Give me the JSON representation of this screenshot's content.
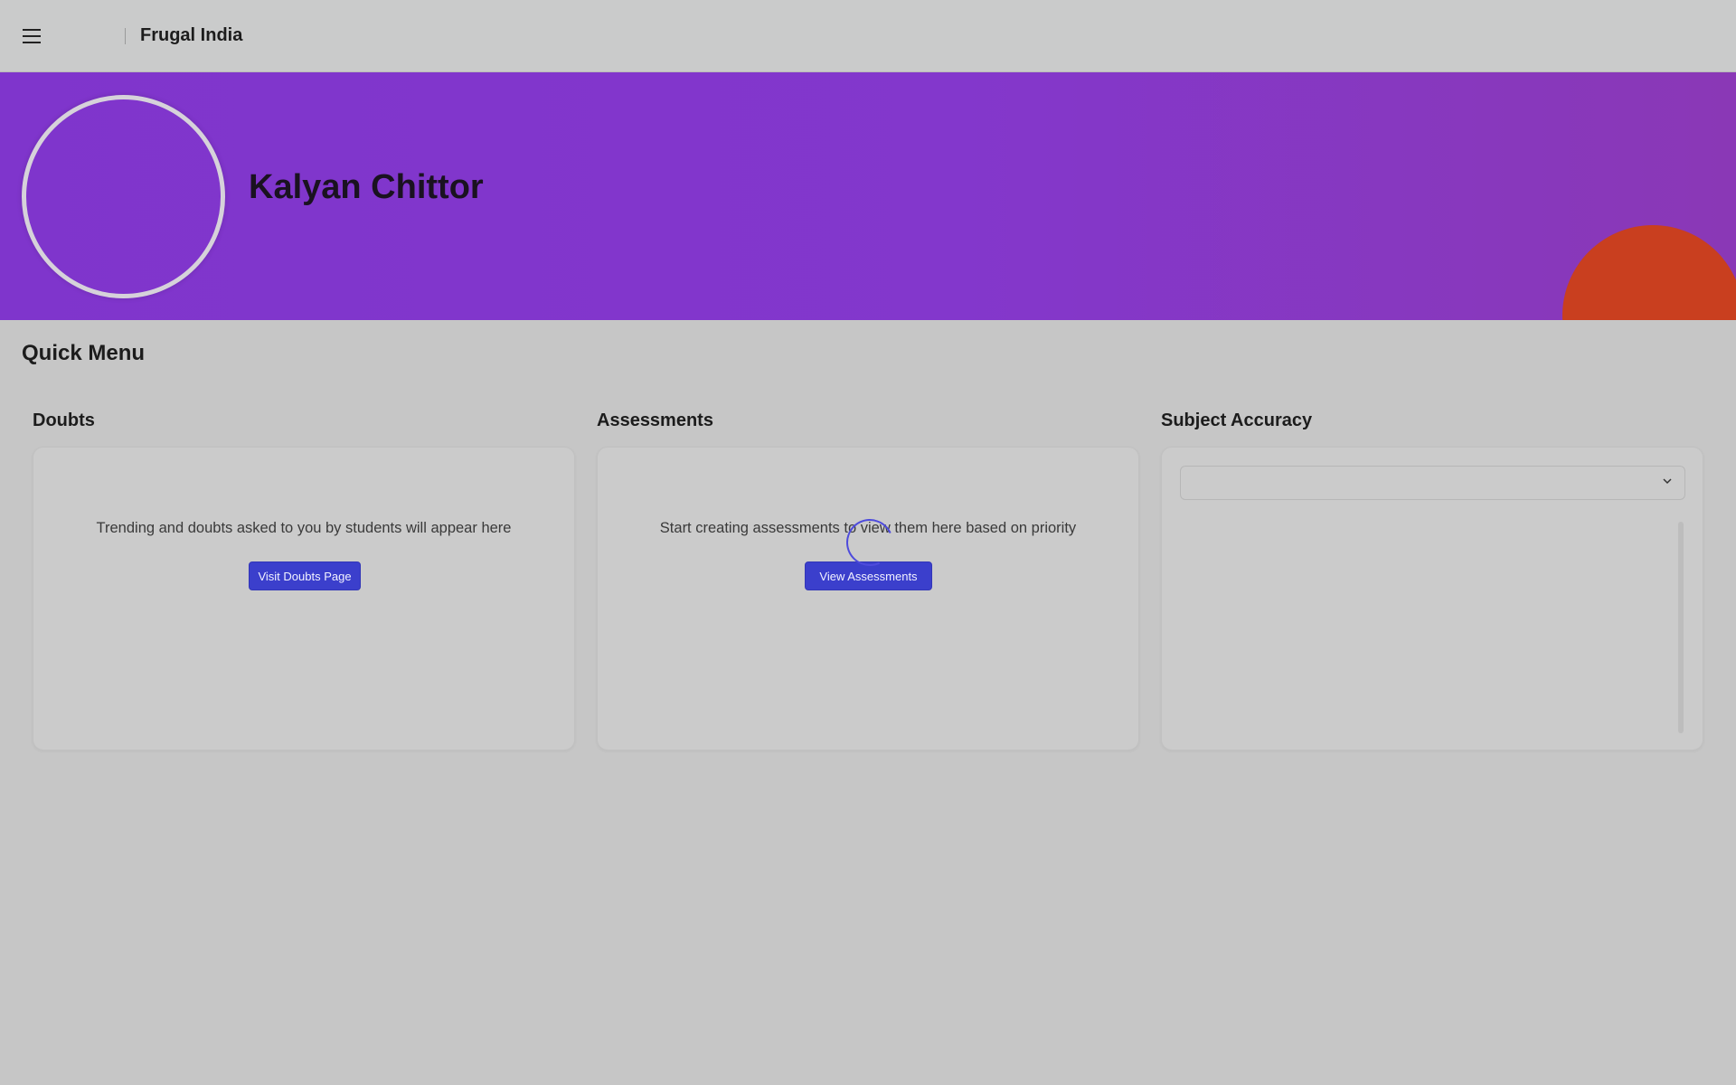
{
  "header": {
    "org_name": "Frugal India",
    "menu_icon": "hamburger-menu-icon"
  },
  "profile": {
    "name": "Kalyan Chittor"
  },
  "quick_menu": {
    "title": "Quick Menu",
    "doubts": {
      "title": "Doubts",
      "message": "Trending and doubts asked to you by students will appear here",
      "button_label": "Visit Doubts Page"
    },
    "assessments": {
      "title": "Assessments",
      "message": "Start creating assessments to view them here based on priority",
      "button_label": "View Assessments"
    },
    "subject_accuracy": {
      "title": "Subject Accuracy",
      "selected_value": ""
    }
  },
  "colors": {
    "banner": "#8337cc",
    "accent_button": "#3b3fcc",
    "decor_circle": "#c93f1f",
    "spinner": "#4e4bdc"
  }
}
